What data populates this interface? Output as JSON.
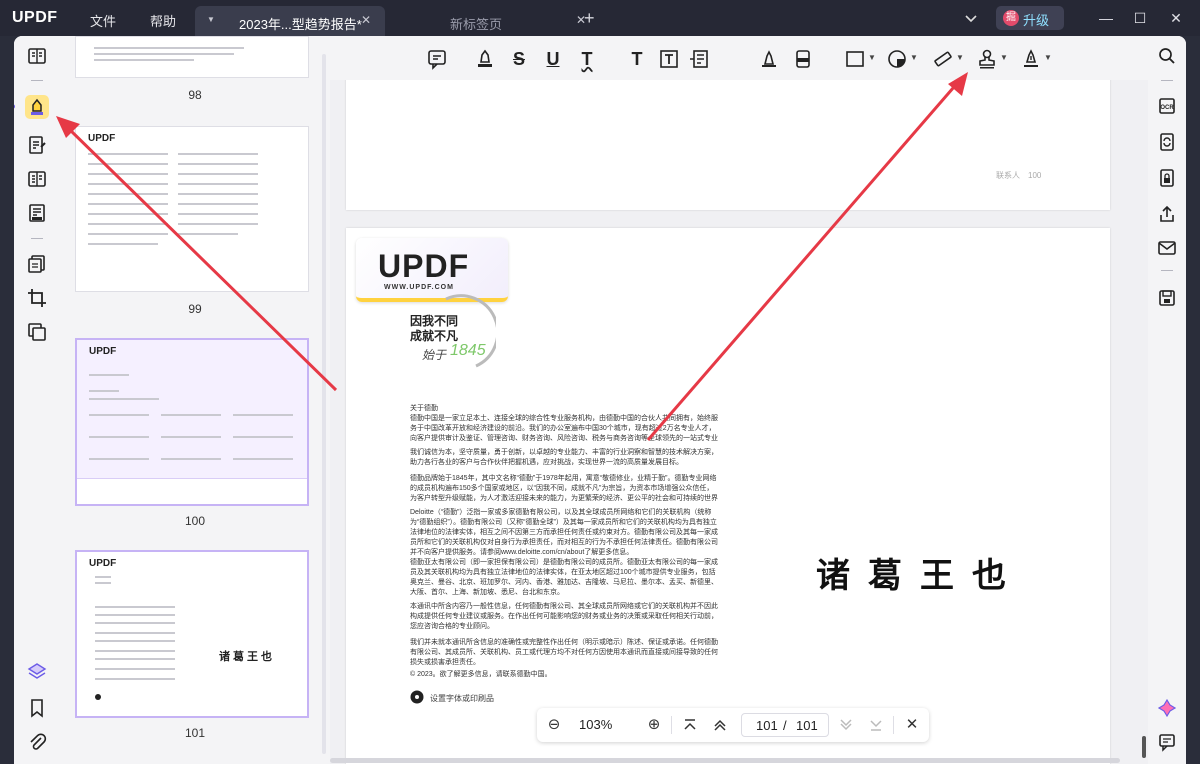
{
  "app": {
    "logo": "UPDF"
  },
  "menu": {
    "file": "文件",
    "help": "帮助"
  },
  "tabs": [
    {
      "label": "2023年...型趋势报告*",
      "active": true
    },
    {
      "label": "新标签页",
      "active": false
    }
  ],
  "upgrade": {
    "badge": "掘",
    "label": "升级"
  },
  "thumbnails": [
    {
      "page": "98"
    },
    {
      "page": "99"
    },
    {
      "page": "100"
    },
    {
      "page": "101"
    }
  ],
  "page_top": {
    "contact_note": "联系人　100"
  },
  "page_main": {
    "logo_word": "UPDF",
    "logo_url": "WWW.UPDF.COM",
    "slogan_line1": "因我不同",
    "slogan_line2": "成就不凡",
    "signature": "始于",
    "signature_year": "1845",
    "paragraphs": [
      "关于德勤",
      "德勤中国是一家立足本土、连接全球的综合性专业服务机构，由德勤中国的合伙人共同拥有，始终服务于中国改革开放和经济建设的前沿。我们的办公室遍布中国30个城市，现有超过2万名专业人才，向客户提供审计及鉴证、管理咨询、财务咨询、风险咨询、税务与商务咨询等全球领先的一站式专业服务。",
      "我们诚信为本，坚守质量，勇于创新，以卓越的专业能力、丰富的行业洞察和智慧的技术解决方案，助力各行各业的客户与合作伙伴把握机遇，应对挑战，实现世界一流的高质量发展目标。",
      "德勤品牌始于1845年，其中文名称“德勤”于1978年起用，寓意“敬德修业，业精于勤”。德勤专业网络的成员机构遍布150多个国家或地区，以“因我不同，成就不凡”为宗旨，为资本市场增强公众信任，为客户转型升级赋能，为人才激活迎接未来的能力，为更繁荣的经济、更公平的社会和可持续的世界而开拓前行。",
      "Deloitte（“德勤”）泛指一家或多家德勤有限公司，以及其全球成员所网络和它们的关联机构（统称为“德勤组织”）。德勤有限公司（又称“德勤全球”）及其每一家成员所和它们的关联机构均为具有独立法律地位的法律实体，相互之间不因第三方而承担任何责任或约束对方。德勤有限公司及其每一家成员所和它们的关联机构仅对自身行为承担责任，而对相互的行为不承担任何法律责任。德勤有限公司并不向客户提供服务。请参阅www.deloitte.com/cn/about了解更多信息。",
      "德勤亚太有限公司（即一家担保有限公司）是德勤有限公司的成员所。德勤亚太有限公司的每一家成员及其关联机构均为具有独立法律地位的法律实体，在亚太地区超过100个城市提供专业服务，包括奥克兰、曼谷、北京、班加罗尔、河内、香港、雅加达、吉隆坡、马尼拉、墨尔本、孟买、新德里、大阪、首尔、上海、新加坡、悉尼、台北和东京。",
      "本通讯中所含内容乃一般性信息，任何德勤有限公司、其全球成员所网络或它们的关联机构并不因此构成提供任何专业建议或服务。在作出任何可能影响您的财务或业务的决策或采取任何相关行动前，您应咨询合格的专业顾问。",
      "我们并未就本通讯所含信息的准确性或完整性作出任何（明示或暗示）陈述、保证或承诺。任何德勤有限公司、其成员所、关联机构、员工或代理方均不对任何方因使用本通讯而直接或间接导致的任何损失或损害承担责任。",
      "© 2023。欲了解更多信息，请联系德勤中国。"
    ],
    "footer_note": "设置字体或印刷品",
    "stamp_text": "诸葛王也"
  },
  "navigation": {
    "zoom": "103%",
    "current_page": "101",
    "slash": "/",
    "total_pages": "101"
  },
  "colors": {
    "titlebar": "#262835",
    "accent": "#6c5ce7",
    "highlight_tool": "#ffe58a",
    "arrow": "#e63946"
  }
}
